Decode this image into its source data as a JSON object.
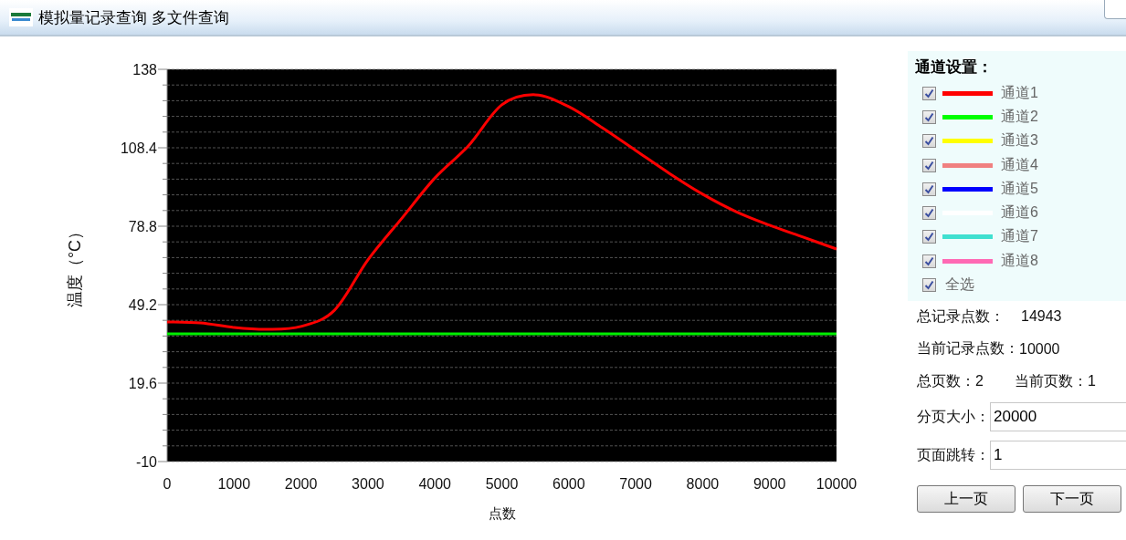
{
  "window": {
    "title": "模拟量记录查询 多文件查询"
  },
  "chart": {
    "chart_data": {
      "type": "line",
      "xlabel": "点数",
      "ylabel": "温度（°C）",
      "x": [
        0,
        500,
        1000,
        1500,
        2000,
        2500,
        3000,
        3500,
        4000,
        4500,
        5000,
        5500,
        6000,
        6500,
        7000,
        7500,
        8000,
        8500,
        9000,
        9500,
        10000
      ],
      "series": [
        {
          "color": "#ff0000",
          "values": [
            42.7,
            42.3,
            40.6,
            39.9,
            41,
            47.1,
            66.1,
            81.6,
            97,
            109.1,
            124.6,
            128.4,
            123.9,
            116,
            107.4,
            98.8,
            90.9,
            84.3,
            79.2,
            74.7,
            70.2
          ]
        },
        {
          "color": "#00ee00",
          "values": [
            38.2,
            38.2,
            38.2,
            38.2,
            38.2,
            38.2,
            38.2,
            38.2,
            38.2,
            38.2,
            38.2,
            38.2,
            38.2,
            38.2,
            38.2,
            38.2,
            38.2,
            38.2,
            38.2,
            38.2,
            38.2
          ]
        }
      ],
      "grid": true,
      "xlim": [
        0,
        10000
      ],
      "ylim": [
        -10,
        138
      ],
      "xticks": [
        0,
        1000,
        2000,
        3000,
        4000,
        5000,
        6000,
        7000,
        8000,
        9000,
        10000
      ],
      "yticks": [
        -10,
        {
          "value": 19.6,
          "label": "19.6"
        },
        {
          "value": 49.2,
          "label": "49.2"
        },
        {
          "value": 78.8,
          "label": "78.8"
        },
        {
          "value": 108.4,
          "label": "108.4"
        },
        138
      ]
    }
  },
  "channel_settings": {
    "title": "通道设置：",
    "channels": [
      {
        "label": "通道1",
        "color": "#ff0000",
        "checked": true
      },
      {
        "label": "通道2",
        "color": "#00ff00",
        "checked": true
      },
      {
        "label": "通道3",
        "color": "#ffff00",
        "checked": true
      },
      {
        "label": "通道4",
        "color": "#f08080",
        "checked": true
      },
      {
        "label": "通道5",
        "color": "#0000ff",
        "checked": true
      },
      {
        "label": "通道6",
        "color": "#ffffff",
        "checked": true
      },
      {
        "label": "通道7",
        "color": "#40e0d0",
        "checked": true
      },
      {
        "label": "通道8",
        "color": "#ff69b4",
        "checked": true
      }
    ],
    "select_all": {
      "label": "全选",
      "checked": true
    }
  },
  "info": {
    "total_points": {
      "label": "总记录点数：",
      "value": "14943"
    },
    "current_points": {
      "label": "当前记录点数：",
      "value": "10000"
    },
    "total_pages": {
      "label": "总页数：",
      "value": "2"
    },
    "current_page": {
      "label": "当前页数：",
      "value": "1"
    }
  },
  "page_size": {
    "label": "分页大小：",
    "value": "20000"
  },
  "page_jump": {
    "label": "页面跳转：",
    "value": "1"
  },
  "buttons": [
    "上一页",
    "下一页"
  ]
}
